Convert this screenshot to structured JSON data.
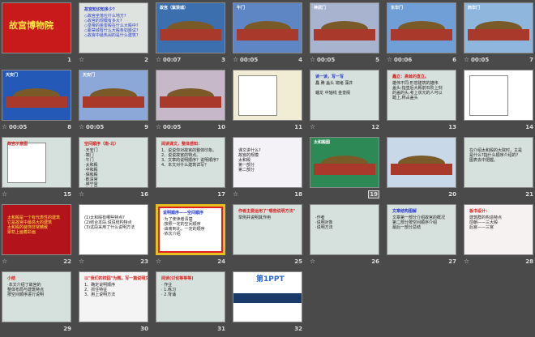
{
  "view": "slide-sorter",
  "slides": [
    {
      "num": "1",
      "star": false,
      "time": "",
      "title": "故宫博物院",
      "bg": "#c81a1a",
      "kind": "title"
    },
    {
      "num": "2",
      "star": true,
      "time": "",
      "title": "故宫知识知多少？",
      "bg": "#dfe3e0",
      "kind": "list",
      "lines": [
        "◇故宫坐落在什么地方?",
        "◇故宫的规模有多大?",
        "◇皇帝的金銮殿在什么大殿中?",
        "◇紫禁城有什么大殿条如盛试?",
        "◇故宫中最热闹的是什么建筑?"
      ]
    },
    {
      "num": "3",
      "star": true,
      "time": "00:07",
      "title": "故宫（紫禁城）",
      "bg": "#3b6fae",
      "kind": "photo"
    },
    {
      "num": "4",
      "star": false,
      "time": "00:05",
      "title": "午门",
      "bg": "#5f86c4",
      "kind": "photo"
    },
    {
      "num": "5",
      "star": false,
      "time": "00:05",
      "title": "神武门",
      "bg": "#a7b3cf",
      "kind": "photo"
    },
    {
      "num": "6",
      "star": false,
      "time": "00:06",
      "title": "东华门",
      "bg": "#6f9fd6",
      "kind": "photo"
    },
    {
      "num": "7",
      "star": false,
      "time": "00:05",
      "title": "西华门",
      "bg": "#8fb7dd",
      "kind": "photo"
    },
    {
      "num": "8",
      "star": false,
      "time": "00:05",
      "title": "天安门",
      "bg": "#2459b8",
      "kind": "photo"
    },
    {
      "num": "9",
      "star": false,
      "time": "00:05",
      "title": "天安门",
      "bg": "#8ba8d8",
      "kind": "photo"
    },
    {
      "num": "10",
      "star": false,
      "time": "00:05",
      "title": "",
      "bg": "#c6b8c8",
      "kind": "photo"
    },
    {
      "num": "11",
      "star": false,
      "time": "",
      "title": "",
      "bg": "#f1ecd4",
      "kind": "map"
    },
    {
      "num": "12",
      "star": true,
      "time": "",
      "title": "读一读，写一写",
      "bg": "#d6e0dc",
      "kind": "list",
      "lines": [
        "矗 腾 盖头 端绪 藻井",
        "",
        "蟠龙  中轴线  金銮殿"
      ]
    },
    {
      "num": "13",
      "star": false,
      "time": "",
      "title": "矗立：高耸的直立。",
      "bg": "#d6e0dc",
      "kind": "list",
      "lines": [
        "雄伟不同:形容建筑的雄伟",
        "盖头:指皇后大殿前石阶上刻",
        "的盖的头,考上状元的人可以",
        "踏上,称占盖头"
      ]
    },
    {
      "num": "14",
      "star": false,
      "time": "",
      "title": "",
      "bg": "#ffffff",
      "kind": "map"
    },
    {
      "num": "15",
      "star": true,
      "time": "",
      "title": "故宫示意图",
      "bg": "#d6e0dc",
      "kind": "map"
    },
    {
      "num": "16",
      "star": true,
      "time": "",
      "title": "空间顺序（南-北）",
      "bg": "#d6e0dc",
      "kind": "list",
      "lines": [
        "·天安门",
        "·端门",
        "·午门",
        "·太和殿",
        "·中和殿",
        "·保和殿",
        "·乾清宫",
        "·坤宁宫",
        "·御花园"
      ]
    },
    {
      "num": "17",
      "star": false,
      "time": "",
      "title": "阅读课文，整体感知：",
      "bg": "#d6e0dc",
      "kind": "list",
      "lines": [
        "1、说说你对故宫的整体印象。",
        "2、说说故宫的特点。",
        "3、文章的说明顺序？说明顺序？",
        "4、本文对什么建筑详写？"
      ]
    },
    {
      "num": "18",
      "star": true,
      "time": "",
      "title": "",
      "bg": "#f4f2f6",
      "kind": "list",
      "lines": [
        "课文讲什么?",
        "故宫的规模",
        "太和殿",
        "第一部分",
        "第二部分"
      ]
    },
    {
      "num": "19",
      "star": false,
      "boxed": true,
      "time": "",
      "title": "太和殿图",
      "bg": "#2d8a56",
      "kind": "photo"
    },
    {
      "num": "20",
      "star": false,
      "time": "",
      "title": "",
      "bg": "#c8d8e8",
      "kind": "photo"
    },
    {
      "num": "21",
      "star": false,
      "time": "",
      "title": "",
      "bg": "#d6e0dc",
      "kind": "list",
      "lines": [
        "在介绍太和殿的大院时，主是",
        "是什么?指什么顺序介绍的?",
        "图表去中把握。"
      ]
    },
    {
      "num": "22",
      "star": true,
      "time": "",
      "title": "",
      "bg": "#b3141c",
      "kind": "list",
      "lines": [
        "太和殿是一个有代表性的建筑",
        "它是故宫中最高大的建筑",
        "太和殿的装饰非常精致",
        "梁枋上画着彩画"
      ]
    },
    {
      "num": "23",
      "star": true,
      "time": "",
      "title": "",
      "bg": "#ffffff",
      "kind": "list",
      "lines": [
        "(1)太和殿有哪些特点?",
        "(2)结合本段,说说结构特点",
        "(3)这段采用了什么说明方法"
      ]
    },
    {
      "num": "24",
      "star": true,
      "time": "",
      "title": "说明顺序——空间顺序",
      "bg": "#ffffff",
      "kind": "frame",
      "lines": [
        "·为了使读者清楚",
        "·按照一定的空间顺序",
        "·由南到北，一定的顺序",
        "·依次介绍"
      ]
    },
    {
      "num": "25",
      "star": false,
      "time": "",
      "title": "作者主要运用了\"哪些说明方法\"",
      "bg": "#d6e0dc",
      "kind": "list",
      "lines": [
        "举例并说明其作用"
      ]
    },
    {
      "num": "26",
      "star": true,
      "time": "",
      "title": "",
      "bg": "#d6e0dc",
      "kind": "list",
      "lines": [
        "·作者",
        "·说明对象",
        "·说明方法"
      ]
    },
    {
      "num": "27",
      "star": false,
      "time": "",
      "title": "文章结构图解",
      "bg": "#d6e0dc",
      "kind": "list",
      "lines": [
        "文章第一部分介绍故宫的概况",
        "第二部分按空间顺序介绍",
        "最后一部分总结"
      ]
    },
    {
      "num": "28",
      "star": true,
      "time": "",
      "title": "板书设计：",
      "bg": "#f6f2f2",
      "kind": "list",
      "lines": [
        "建筑群的构造特点",
        "前朝——三大殿",
        "后宫——三宫"
      ]
    },
    {
      "num": "29",
      "star": false,
      "time": "",
      "title": "小结",
      "bg": "#d6e0dc",
      "kind": "list",
      "lines": [
        "·本文介绍了故宫的",
        "整体布局与建筑特点",
        "按空间顺序进行说明"
      ]
    },
    {
      "num": "30",
      "star": false,
      "time": "",
      "title": "以\"我们的校园\"为题，写一篇说明文。",
      "bg": "#f4f4f4",
      "kind": "list",
      "lines": [
        "1、确定说明顺序",
        "2、抓住特征",
        "3、用上说明方法"
      ]
    },
    {
      "num": "31",
      "star": false,
      "time": "",
      "title": "阅读(讨论等等等)",
      "bg": "#d6e0dc",
      "kind": "list",
      "lines": [
        "· 作业",
        "· 1.练习",
        "· 2.背诵"
      ]
    },
    {
      "num": "32",
      "star": false,
      "time": "",
      "title": "第1PPT",
      "bg": "#ffffff",
      "kind": "brand"
    }
  ],
  "colors": {
    "background": "#4a4a4a",
    "label": "#dddddd",
    "red": "#e0201e",
    "blue": "#2a3ccc"
  },
  "icons": {
    "transition": "star-icon"
  }
}
